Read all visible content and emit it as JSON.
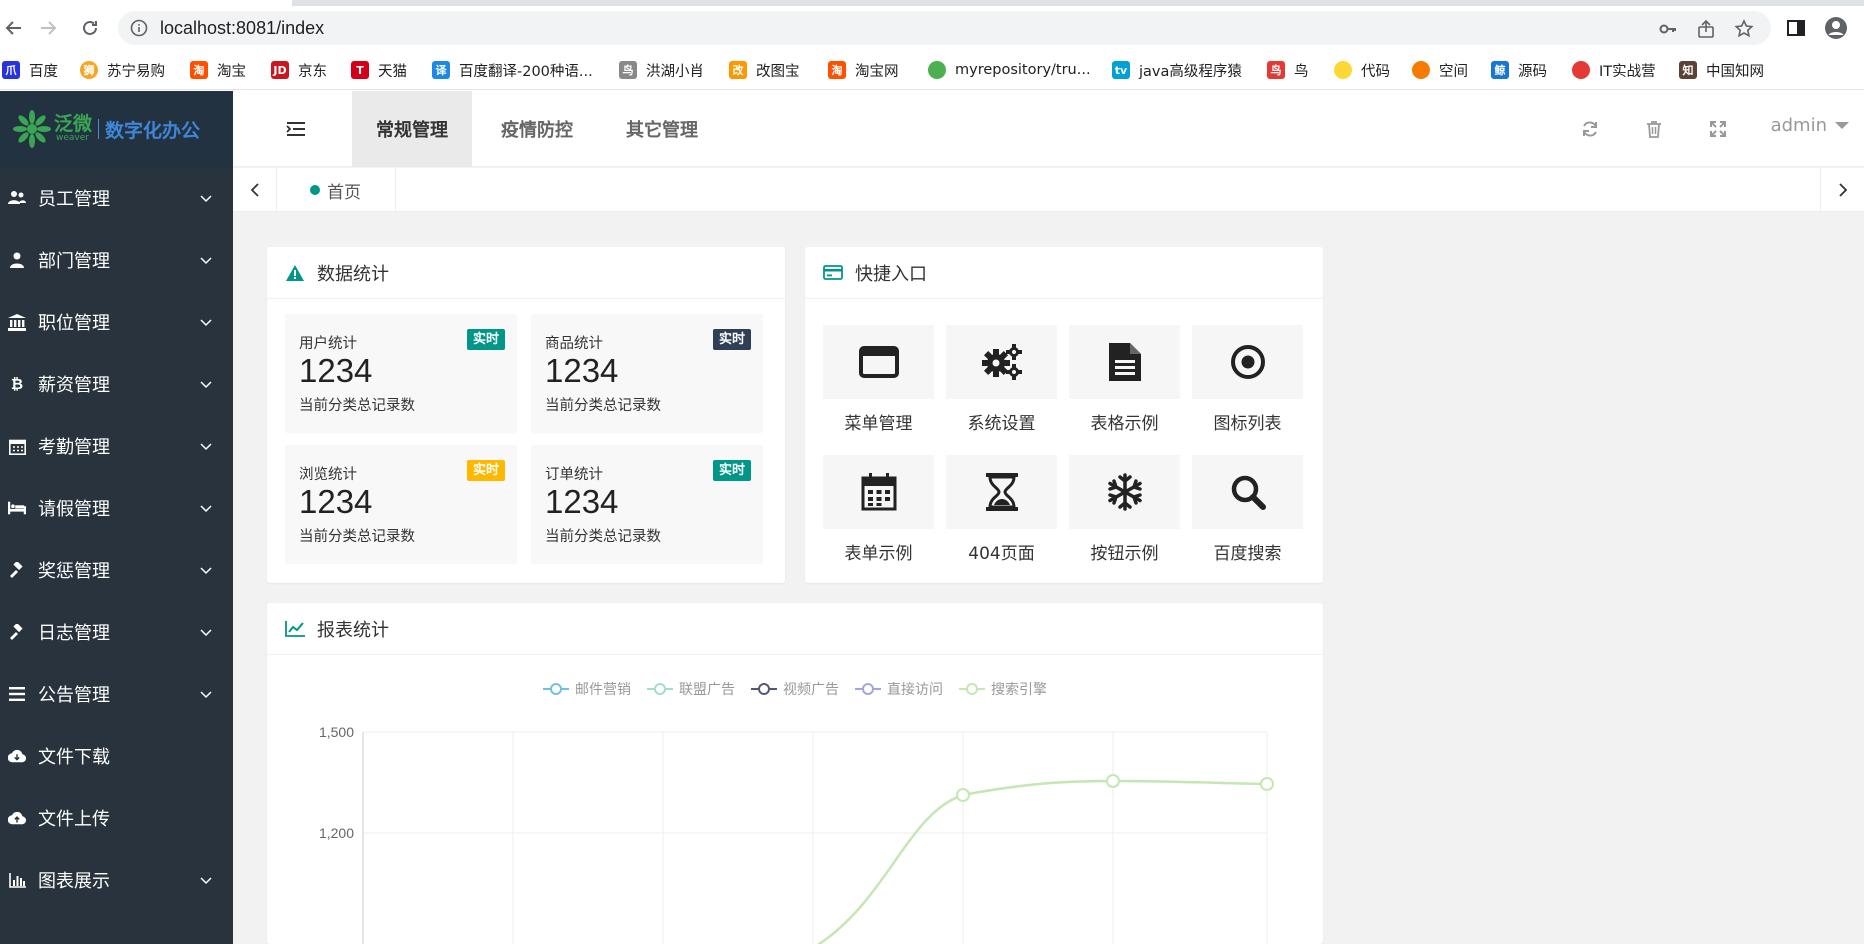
{
  "browser": {
    "url": "localhost:8081/index",
    "bookmarks": [
      {
        "label": "百度",
        "icon": "baidu-paw-icon",
        "color": "#2932e1"
      },
      {
        "label": "苏宁易购",
        "icon": "suning-lion-icon",
        "color": "#f5a623"
      },
      {
        "label": "淘宝",
        "icon": "taobao-icon",
        "color": "#ff5000"
      },
      {
        "label": "京东",
        "icon": "jd-icon",
        "color": "#c81623"
      },
      {
        "label": "天猫",
        "icon": "tmall-icon",
        "color": "#d4001a"
      },
      {
        "label": "百度翻译-200种语...",
        "icon": "baidu-translate-icon",
        "color": "#1e88e5"
      },
      {
        "label": "洪湖小肖",
        "icon": "bird-icon",
        "color": "#888888"
      },
      {
        "label": "改图宝",
        "icon": "gaitubao-icon",
        "color": "#ff9800"
      },
      {
        "label": "淘宝网",
        "icon": "taobao-icon",
        "color": "#ff5000"
      },
      {
        "label": "myrepository/tru...",
        "icon": "chrome-icon",
        "color": "#4caf50"
      },
      {
        "label": "java高级程序猿",
        "icon": "bilibili-icon",
        "color": "#00a1d6"
      },
      {
        "label": "鸟",
        "icon": "bird-icon",
        "color": "#e53935"
      },
      {
        "label": "代码",
        "icon": "code-icon",
        "color": "#fdd835"
      },
      {
        "label": "空间",
        "icon": "space-icon",
        "color": "#f57c00"
      },
      {
        "label": "源码",
        "icon": "whale-icon",
        "color": "#1976d2"
      },
      {
        "label": "IT实战营",
        "icon": "chrome-icon",
        "color": "#e53935"
      },
      {
        "label": "中国知网",
        "icon": "cnki-icon",
        "color": "#5d4037"
      }
    ]
  },
  "sidebar": {
    "logo": {
      "brand": "泛微",
      "brand_sub": "weaver",
      "text": "数字化办公"
    },
    "items": [
      {
        "label": "员工管理",
        "icon": "users-icon",
        "has_chevron": true
      },
      {
        "label": "部门管理",
        "icon": "user-icon",
        "has_chevron": true
      },
      {
        "label": "职位管理",
        "icon": "bank-icon",
        "has_chevron": true
      },
      {
        "label": "薪资管理",
        "icon": "bitcoin-icon",
        "has_chevron": true
      },
      {
        "label": "考勤管理",
        "icon": "calendar-icon",
        "has_chevron": true
      },
      {
        "label": "请假管理",
        "icon": "bed-icon",
        "has_chevron": true
      },
      {
        "label": "奖惩管理",
        "icon": "gavel-icon",
        "has_chevron": true
      },
      {
        "label": "日志管理",
        "icon": "gavel-icon",
        "has_chevron": true
      },
      {
        "label": "公告管理",
        "icon": "list-icon",
        "has_chevron": true
      },
      {
        "label": "文件下载",
        "icon": "cloud-download-icon",
        "has_chevron": false
      },
      {
        "label": "文件上传",
        "icon": "cloud-upload-icon",
        "has_chevron": false
      },
      {
        "label": "图表展示",
        "icon": "bar-chart-icon",
        "has_chevron": true
      }
    ]
  },
  "header": {
    "tabs": [
      {
        "label": "常规管理",
        "active": true
      },
      {
        "label": "疫情防控",
        "active": false
      },
      {
        "label": "其它管理",
        "active": false
      }
    ],
    "user": "admin"
  },
  "page_tabs": [
    {
      "label": "首页"
    }
  ],
  "data_stats": {
    "title": "数据统计",
    "cards": [
      {
        "title": "用户统计",
        "badge": "实时",
        "badge_color": "#009688",
        "value": "1234",
        "desc": "当前分类总记录数"
      },
      {
        "title": "商品统计",
        "badge": "实时",
        "badge_color": "#2f4056",
        "value": "1234",
        "desc": "当前分类总记录数"
      },
      {
        "title": "浏览统计",
        "badge": "实时",
        "badge_color": "#ffb800",
        "value": "1234",
        "desc": "当前分类总记录数"
      },
      {
        "title": "订单统计",
        "badge": "实时",
        "badge_color": "#009688",
        "value": "1234",
        "desc": "当前分类总记录数"
      }
    ]
  },
  "quick_entry": {
    "title": "快捷入口",
    "items": [
      {
        "label": "菜单管理",
        "icon": "window-icon"
      },
      {
        "label": "系统设置",
        "icon": "gears-icon"
      },
      {
        "label": "表格示例",
        "icon": "file-text-icon"
      },
      {
        "label": "图标列表",
        "icon": "dot-circle-icon"
      },
      {
        "label": "表单示例",
        "icon": "calendar-icon"
      },
      {
        "label": "404页面",
        "icon": "hourglass-icon"
      },
      {
        "label": "按钮示例",
        "icon": "snowflake-icon"
      },
      {
        "label": "百度搜索",
        "icon": "search-icon"
      }
    ]
  },
  "report": {
    "title": "报表统计"
  },
  "chart_data": {
    "type": "line",
    "series": [
      {
        "name": "邮件营销",
        "color": "#91cc75"
      },
      {
        "name": "联盟广告",
        "color": "#91cc75"
      },
      {
        "name": "视频广告",
        "color": "#5470c6"
      },
      {
        "name": "直接访问",
        "color": "#5470c6"
      },
      {
        "name": "搜索引擎",
        "color": "#91cc75",
        "values": [
          null,
          null,
          null,
          1000,
          1290,
          1320,
          1310
        ]
      }
    ],
    "y_ticks": [
      "1,500",
      "1,200"
    ],
    "grid": true,
    "legend_position": "top-center"
  }
}
